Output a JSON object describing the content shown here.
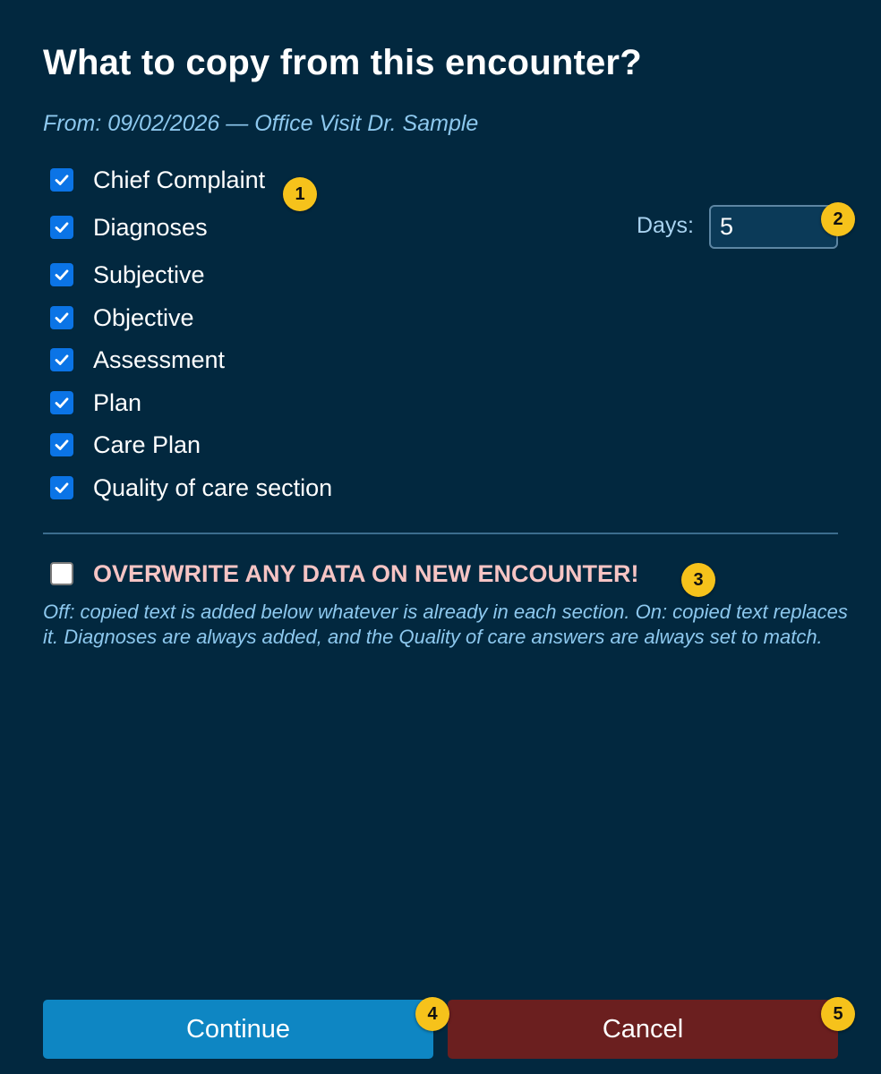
{
  "dialog": {
    "title": "What to copy from this encounter?",
    "source_line": "From: 09/02/2026 — Office Visit Dr. Sample"
  },
  "sections": [
    {
      "label": "Chief Complaint",
      "checked": true
    },
    {
      "label": "Diagnoses",
      "checked": true
    },
    {
      "label": "Subjective",
      "checked": true
    },
    {
      "label": "Objective",
      "checked": true
    },
    {
      "label": "Assessment",
      "checked": true
    },
    {
      "label": "Plan",
      "checked": true
    },
    {
      "label": "Care Plan",
      "checked": true
    },
    {
      "label": "Quality of care section",
      "checked": true
    }
  ],
  "days": {
    "label": "Days:",
    "value": "5"
  },
  "overwrite": {
    "label": "OVERWRITE ANY DATA ON NEW ENCOUNTER!",
    "checked": false,
    "note": "Off: copied text is added below whatever is already in each section. On: copied text replaces it. Diagnoses are always added, and the Quality of care answers are always set to match."
  },
  "buttons": {
    "continue_label": "Continue",
    "cancel_label": "Cancel"
  },
  "badges": [
    "1",
    "2",
    "3",
    "4",
    "5"
  ],
  "colors": {
    "background": "#02283f",
    "checkbox_checked": "#0b74e6",
    "continue_button": "#0e86c3",
    "cancel_button": "#6b1f1f",
    "warning_text": "#f6c4c4",
    "muted_text": "#8dc8ee",
    "badge": "#f6c21b"
  },
  "icons": {
    "checked": "check-icon"
  }
}
